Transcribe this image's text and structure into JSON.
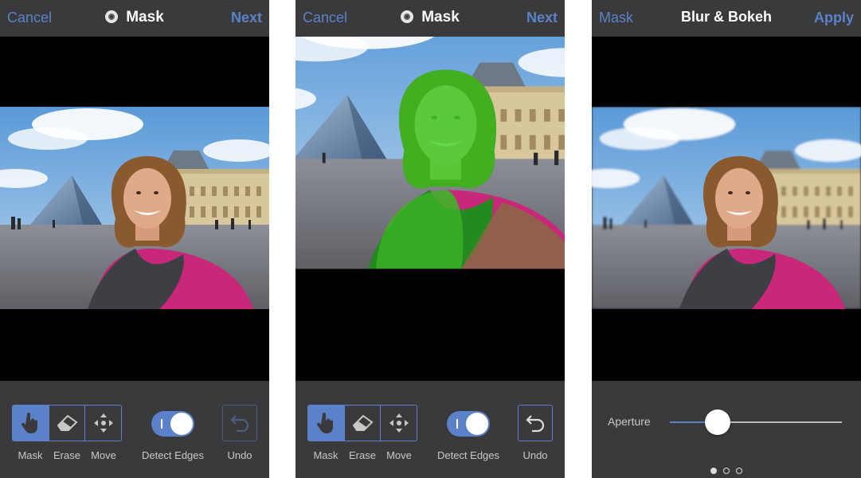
{
  "screens": [
    {
      "topbar": {
        "left": "Cancel",
        "title": "Mask",
        "right": "Next"
      },
      "tools": [
        "Mask",
        "Erase",
        "Move"
      ],
      "active_tool": "Mask",
      "toggle_label": "Detect Edges",
      "toggle_on": true,
      "undo_label": "Undo",
      "undo_enabled": false,
      "mask_overlay": false
    },
    {
      "topbar": {
        "left": "Cancel",
        "title": "Mask",
        "right": "Next"
      },
      "tools": [
        "Mask",
        "Erase",
        "Move"
      ],
      "active_tool": "Mask",
      "toggle_label": "Detect Edges",
      "toggle_on": true,
      "undo_label": "Undo",
      "undo_enabled": true,
      "mask_overlay": true,
      "mask_color": "#33c21f"
    },
    {
      "topbar": {
        "left": "Mask",
        "title": "Blur & Bokeh",
        "right": "Apply"
      },
      "slider_label": "Aperture",
      "slider_value": 0.28,
      "pager": {
        "count": 3,
        "active": 0
      }
    }
  ],
  "colors": {
    "accent": "#5b82c8",
    "bar": "#3a3a3c",
    "text_dim": "#c8c8c8"
  },
  "icons": [
    "hand-icon",
    "eraser-icon",
    "move-icon",
    "undo-icon",
    "mask-ring-icon"
  ]
}
